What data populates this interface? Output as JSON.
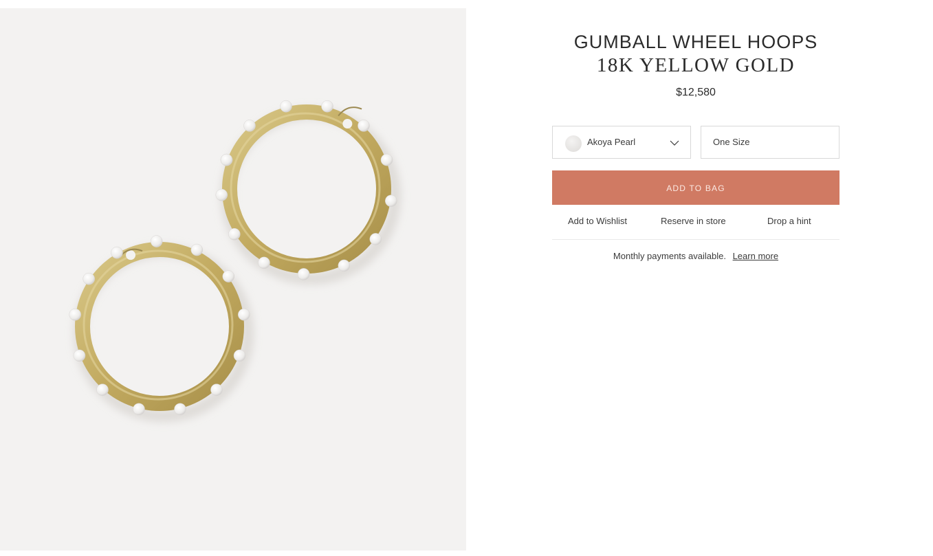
{
  "product": {
    "title": "GUMBALL WHEEL HOOPS",
    "subtitle": "18K YELLOW GOLD",
    "price": "$12,580",
    "image_alt": "Gumball Wheel Hoops earrings"
  },
  "options": {
    "stone": {
      "selected": "Akoya Pearl",
      "swatch_color": "#e6e4e2"
    },
    "size": {
      "selected": "One Size"
    }
  },
  "actions": {
    "add_to_bag": "ADD TO BAG",
    "wishlist": "Add to Wishlist",
    "reserve": "Reserve in store",
    "hint": "Drop a hint"
  },
  "payments": {
    "text": "Monthly payments available.",
    "link": "Learn more"
  },
  "colors": {
    "accent": "#d07a63",
    "gallery_bg": "#f3f2f1",
    "gold": "#c6b06a"
  }
}
